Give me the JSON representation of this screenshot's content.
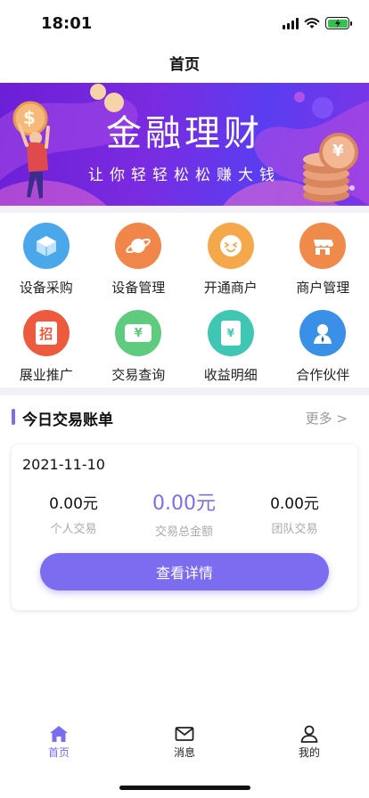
{
  "status_bar": {
    "time": "18:01"
  },
  "nav": {
    "title": "首页"
  },
  "banner": {
    "title": "金融理财",
    "subtitle": "让你轻轻松松赚大钱",
    "coin_glyph": "$",
    "stack_glyph": "¥"
  },
  "menu": [
    {
      "label": "设备采购",
      "icon": "cube-icon",
      "color": "#4aa8ea",
      "glyph": ""
    },
    {
      "label": "设备管理",
      "icon": "planet-icon",
      "color": "#f0864a",
      "glyph": ""
    },
    {
      "label": "开通商户",
      "icon": "smile-icon",
      "color": "#f5a84a",
      "glyph": ""
    },
    {
      "label": "商户管理",
      "icon": "store-icon",
      "color": "#f08a4a",
      "glyph": ""
    },
    {
      "label": "展业推广",
      "icon": "recruit-icon",
      "color": "#ee5a3e",
      "glyph": "招"
    },
    {
      "label": "交易查询",
      "icon": "ticket-icon",
      "color": "#5ecb7e",
      "glyph": "¥"
    },
    {
      "label": "收益明细",
      "icon": "envelope-icon",
      "color": "#3fc7b4",
      "glyph": "¥"
    },
    {
      "label": "合作伙伴",
      "icon": "partner-icon",
      "color": "#3a8fe6",
      "glyph": ""
    }
  ],
  "section": {
    "title": "今日交易账单",
    "more": "更多 >"
  },
  "card": {
    "date": "2021-11-10",
    "stats": [
      {
        "value": "0.00元",
        "label": "个人交易"
      },
      {
        "value": "0.00元",
        "label": "交易总金额"
      },
      {
        "value": "0.00元",
        "label": "团队交易"
      }
    ],
    "button": "查看详情"
  },
  "tabbar": [
    {
      "label": "首页",
      "icon": "home-icon"
    },
    {
      "label": "消息",
      "icon": "mail-icon"
    },
    {
      "label": "我的",
      "icon": "user-icon"
    }
  ],
  "colors": {
    "accent": "#7b6cf0",
    "banner": "#6b1fd6"
  }
}
